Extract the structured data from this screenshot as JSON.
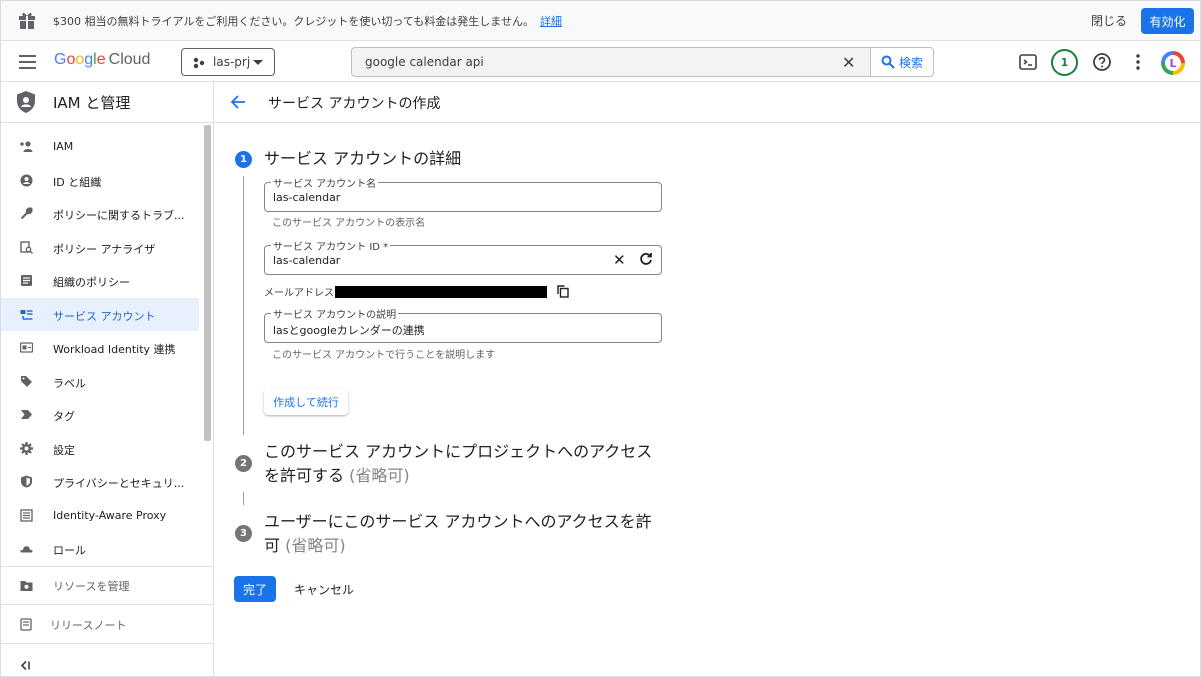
{
  "banner": {
    "message": "$300 相当の無料トライアルをご利用ください。クレジットを使い切っても料金は発生しません。",
    "details_link": "詳細",
    "close_label": "閉じる",
    "enable_label": "有効化"
  },
  "topbar": {
    "logo_google": [
      "G",
      "o",
      "o",
      "g",
      "l",
      "e"
    ],
    "logo_cloud": "Cloud",
    "project": "las-prj",
    "search_value": "google calendar api",
    "search_button": "検索",
    "notification_count": "1",
    "avatar_letter": "L"
  },
  "sidebar": {
    "title": "IAM と管理",
    "items": [
      {
        "label": "IAM",
        "icon": "person-add-icon"
      },
      {
        "label": "ID と組織",
        "icon": "account-circle-icon"
      },
      {
        "label": "ポリシーに関するトラブ...",
        "icon": "wrench-icon"
      },
      {
        "label": "ポリシー アナライザ",
        "icon": "policy-analyzer-icon"
      },
      {
        "label": "組織のポリシー",
        "icon": "document-icon"
      },
      {
        "label": "サービス アカウント",
        "icon": "service-account-icon",
        "active": true
      },
      {
        "label": "Workload Identity 連携",
        "icon": "id-card-icon"
      },
      {
        "label": "ラベル",
        "icon": "label-icon"
      },
      {
        "label": "タグ",
        "icon": "tag-icon"
      },
      {
        "label": "設定",
        "icon": "gear-icon"
      },
      {
        "label": "プライバシーとセキュリ...",
        "icon": "shield-icon"
      },
      {
        "label": "Identity-Aware Proxy",
        "icon": "proxy-icon"
      },
      {
        "label": "ロール",
        "icon": "hat-icon"
      }
    ],
    "manage_resources": "リソースを管理",
    "release_notes": "リリースノート"
  },
  "page": {
    "title": "サービス アカウントの作成"
  },
  "steps": [
    {
      "num": "1",
      "title": "サービス アカウントの詳細",
      "optional": ""
    },
    {
      "num": "2",
      "title": "このサービス アカウントにプロジェクトへのアクセスを許可する",
      "optional": "(省略可)"
    },
    {
      "num": "3",
      "title": "ユーザーにこのサービス アカウントへのアクセスを許可",
      "optional": "(省略可)"
    }
  ],
  "form": {
    "name_label": "サービス アカウント名",
    "name_value": "las-calendar",
    "name_hint": "このサービス アカウントの表示名",
    "id_label": "サービス アカウント ID *",
    "id_value": "las-calendar",
    "email_label": "メールアドレス:",
    "desc_label": "サービス アカウントの説明",
    "desc_value": "lasとgoogleカレンダーの連携",
    "desc_hint": "このサービス アカウントで行うことを説明します",
    "create_continue": "作成して続行"
  },
  "footer": {
    "done": "完了",
    "cancel": "キャンセル"
  }
}
